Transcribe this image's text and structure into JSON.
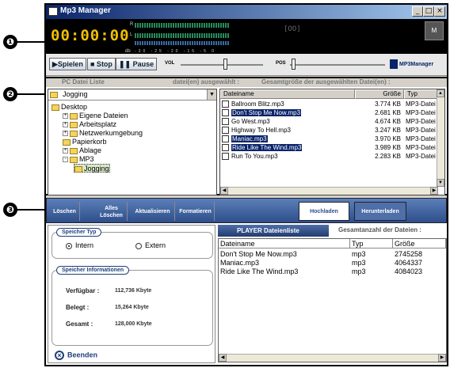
{
  "markers": [
    "❶",
    "❷",
    "❸"
  ],
  "window": {
    "title": "Mp3 Manager",
    "min": "_",
    "max": "□",
    "close": "×"
  },
  "player": {
    "time": "00:00:00",
    "vu_r": "R",
    "vu_l": "L",
    "vu_db": "db",
    "vu_scale": "-30  -25  -20  -15  -5  0",
    "lcd": "[OO]",
    "logo": "M",
    "play": "▶Spielen",
    "stop": "■ Stop",
    "pause": "❚❚ Pause",
    "vol_label": "VOL",
    "pos_label": "POS",
    "brand": "MP3Manager",
    "volume_level": 0.55,
    "position_level": 0.02
  },
  "pc": {
    "header_title": "PC Datei Liste",
    "header_selected": "datei(en) ausgewählt :",
    "header_size": "Gesamtgröße der ausgewählten Datei(en) :",
    "combo_value": "Jogging",
    "tree": [
      {
        "label": "Desktop",
        "depth": 0,
        "expander": ""
      },
      {
        "label": "Eigene Dateien",
        "depth": 1,
        "expander": "+"
      },
      {
        "label": "Arbeitsplatz",
        "depth": 1,
        "expander": "+"
      },
      {
        "label": "Netzwerkumgebung",
        "depth": 1,
        "expander": "+"
      },
      {
        "label": "Papierkorb",
        "depth": 1,
        "expander": ""
      },
      {
        "label": "Ablage",
        "depth": 1,
        "expander": "+"
      },
      {
        "label": "MP3",
        "depth": 1,
        "expander": "-"
      },
      {
        "label": "Jogging",
        "depth": 2,
        "expander": ""
      }
    ],
    "columns": {
      "name": "Dateiname",
      "size": "Größe",
      "type": "Typ"
    },
    "files": [
      {
        "name": "Ballroom Blitz.mp3",
        "size": "3.774 KB",
        "type": "MP3-Datei",
        "selected": false
      },
      {
        "name": "Don't Stop Me Now.mp3",
        "size": "2.681 KB",
        "type": "MP3-Datei",
        "selected": true
      },
      {
        "name": "Go West.mp3",
        "size": "4.674 KB",
        "type": "MP3-Datei",
        "selected": false
      },
      {
        "name": "Highway To Hell.mp3",
        "size": "3.247 KB",
        "type": "MP3-Datei",
        "selected": false
      },
      {
        "name": "Maniac.mp3",
        "size": "3.970 KB",
        "type": "MP3-Datei",
        "selected": true
      },
      {
        "name": "Ride Like The Wind.mp3",
        "size": "3.989 KB",
        "type": "MP3-Datei",
        "selected": true
      },
      {
        "name": "Run To You.mp3",
        "size": "2.283 KB",
        "type": "MP3-Datei",
        "selected": false
      }
    ]
  },
  "device": {
    "toolbar": {
      "delete": "Löschen",
      "delete_all": "Alles Löschen",
      "refresh": "Aktualisieren",
      "format": "Formatieren",
      "upload": "Hochladen",
      "download": "Herunterladen"
    },
    "storage_type_title": "Speicher Typ",
    "internal": "Intern",
    "external": "Extern",
    "storage_info_title": "Speicher Informationen",
    "available_label": "Verfügbar :",
    "available_value": "112,736 Kbyte",
    "used_label": "Belegt :",
    "used_value": "15,264 Kbyte",
    "total_label": "Gesamt :",
    "total_value": "128,000 Kbyte",
    "exit": "Beenden",
    "list_title": "PLAYER Dateienliste",
    "list_total": "Gesamtanzahl der Dateien :",
    "columns": {
      "name": "Dateiname",
      "type": "Typ",
      "size": "Größe"
    },
    "files": [
      {
        "name": "Don't Stop Me Now.mp3",
        "type": "mp3",
        "size": "2745258"
      },
      {
        "name": "Maniac.mp3",
        "type": "mp3",
        "size": "4064337"
      },
      {
        "name": "Ride Like The Wind.mp3",
        "type": "mp3",
        "size": "4084023"
      }
    ]
  }
}
